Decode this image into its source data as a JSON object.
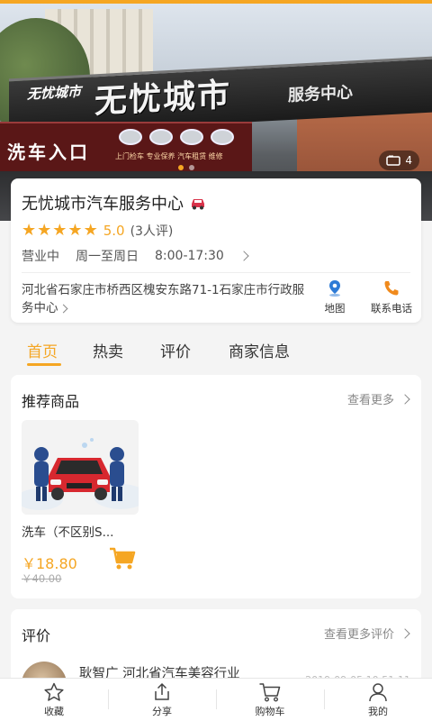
{
  "hero": {
    "sign_logo": "无忧城市",
    "sign_main": "无忧城市",
    "sign_sub": "服务中心",
    "entrance": "洗车入口",
    "entrance_sub": "上门检车 专业保养 汽车租赁 维修",
    "photo_count": "4"
  },
  "store": {
    "name": "无忧城市汽车服务中心",
    "score": "5.0",
    "reviews": "(3人评)",
    "status": "营业中",
    "days": "周一至周日",
    "hours": "8:00-17:30",
    "address": "河北省石家庄市桥西区槐安东路71-1石家庄市行政服务中心"
  },
  "actions": {
    "map": "地图",
    "phone": "联系电话"
  },
  "tabs": [
    "首页",
    "热卖",
    "评价",
    "商家信息"
  ],
  "recommended": {
    "title": "推荐商品",
    "more": "查看更多",
    "product": {
      "name": "洗车（不区别S...",
      "price": "￥18.80",
      "original_price": "￥40.00"
    }
  },
  "evaluation": {
    "title": "评价",
    "more": "查看更多评价",
    "reviewer": "耿智广 河北省汽车美容行业",
    "date": "2019-09-05 10:51:11"
  },
  "bottom_nav": {
    "favorite": "收藏",
    "share": "分享",
    "cart": "购物车",
    "mine": "我的"
  },
  "colors": {
    "accent": "#f5a623"
  }
}
